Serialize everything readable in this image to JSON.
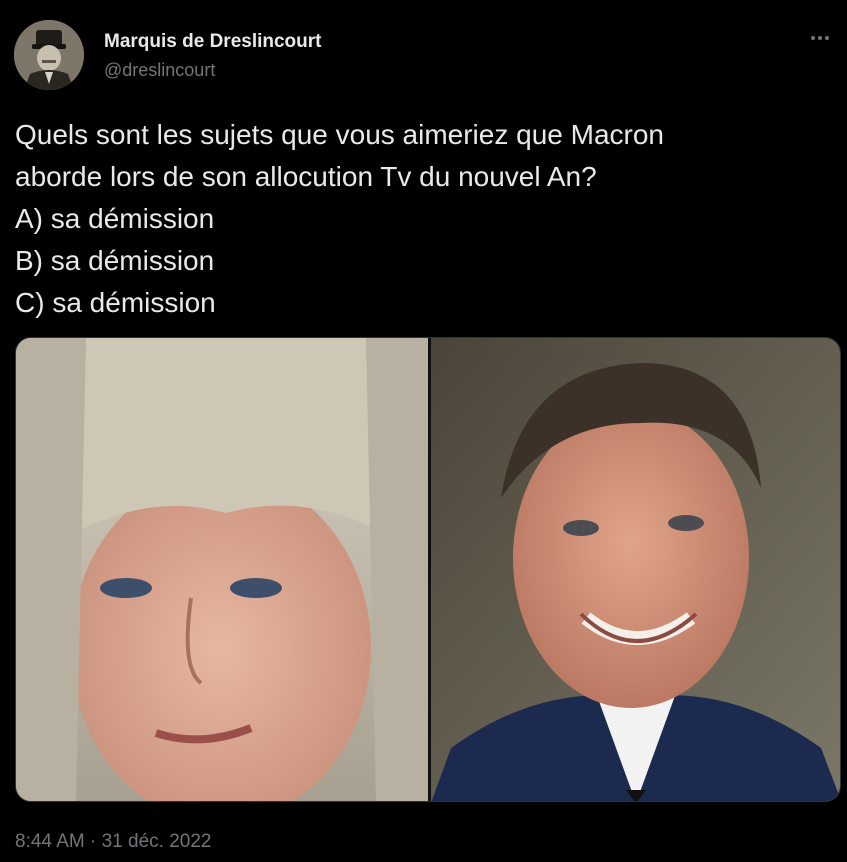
{
  "author": {
    "name": "Marquis de Dreslincourt",
    "handle": "@dreslincourt"
  },
  "tweet": {
    "lines": [
      "Quels sont les sujets que vous aimeriez que Macron",
      "aborde lors de son allocution Tv du nouvel An?",
      "A) sa démission",
      "B) sa démission",
      "C) sa démission"
    ],
    "timestamp": "8:44 AM · 31 déc. 2022"
  },
  "icons": {
    "more": "more-horizontal-icon",
    "avatar": "avatar-portrait"
  },
  "colors": {
    "background": "#000000",
    "primary_text": "#e7e9ea",
    "secondary_text": "#71767b"
  }
}
